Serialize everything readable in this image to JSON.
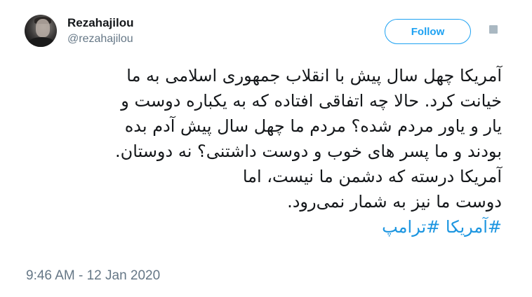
{
  "user": {
    "display_name": "Rezahajilou",
    "handle": "@rezahajilou"
  },
  "follow_button": {
    "label": "Follow"
  },
  "tweet": {
    "lines": [
      "آمریکا چهل سال پیش با انقلاب جمهوری اسلامی به ما",
      "خیانت کرد. حالا چه اتفاقی افتاده که به یکباره دوست و",
      "یار و یاور مردم شده؟ مردم ما چهل سال پیش آدم بده",
      "بودند و ما پسر های خوب و دوست داشتنی؟ نه دوستان.",
      "آمریکا درسته که دشمن ما نیست، اما",
      "دوست ما نیز به شمار نمی‌رود."
    ],
    "hashtags": [
      "#آمریکا",
      "#ترامپ"
    ],
    "timestamp": "9:46 AM - 12 Jan 2020"
  },
  "colors": {
    "link_blue": "#1da1f2",
    "hashtag_blue": "#1b95e0",
    "muted_gray": "#657786",
    "text_dark": "#14171a"
  },
  "icons": {
    "avatar": "profile-photo",
    "caret": "chevron-down-icon"
  }
}
